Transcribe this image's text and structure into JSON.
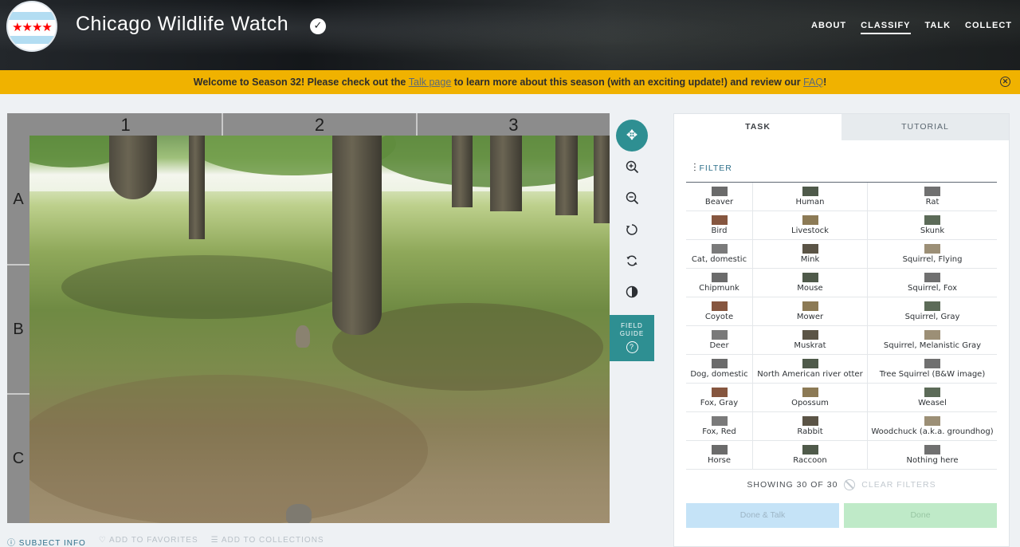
{
  "header": {
    "title": "Chicago Wildlife Watch",
    "nav": [
      "ABOUT",
      "CLASSIFY",
      "TALK",
      "COLLECT"
    ]
  },
  "announcement": {
    "prefix": "Welcome to Season 32! Please check out the ",
    "talk_link": "Talk page",
    "middle": " to learn more about this season (with an exciting update!) and review our ",
    "faq_link": "FAQ",
    "suffix": "!"
  },
  "viewer": {
    "columns": [
      "1",
      "2",
      "3"
    ],
    "rows": [
      "A",
      "B",
      "C"
    ],
    "field_guide": "FIELD GUIDE"
  },
  "subject_links": {
    "info": "SUBJECT INFO",
    "favorites": "ADD TO FAVORITES",
    "collections": "ADD TO COLLECTIONS"
  },
  "panel": {
    "tab_task": "TASK",
    "tab_tutorial": "TUTORIAL",
    "filter": "FILTER",
    "showing": "SHOWING 30 OF 30",
    "clear_filters": "CLEAR FILTERS",
    "done_talk": "Done & Talk",
    "done": "Done",
    "species_rows": [
      [
        "Beaver",
        "Human",
        "Rat"
      ],
      [
        "Bird",
        "Livestock",
        "Skunk"
      ],
      [
        "Cat, domestic",
        "Mink",
        "Squirrel, Flying"
      ],
      [
        "Chipmunk",
        "Mouse",
        "Squirrel, Fox"
      ],
      [
        "Coyote",
        "Mower",
        "Squirrel, Gray"
      ],
      [
        "Deer",
        "Muskrat",
        "Squirrel, Melanistic Gray"
      ],
      [
        "Dog, domestic",
        "North American river otter",
        "Tree Squirrel (B&W image)"
      ],
      [
        "Fox, Gray",
        "Opossum",
        "Weasel"
      ],
      [
        "Fox, Red",
        "Rabbit",
        "Woodchuck (a.k.a. groundhog)"
      ],
      [
        "Horse",
        "Raccoon",
        "Nothing here"
      ]
    ]
  },
  "colors": {
    "accent": "#2e8f92",
    "banner": "#f0b200",
    "done_talk": "#c5e3f7",
    "done": "#bfeac8"
  }
}
